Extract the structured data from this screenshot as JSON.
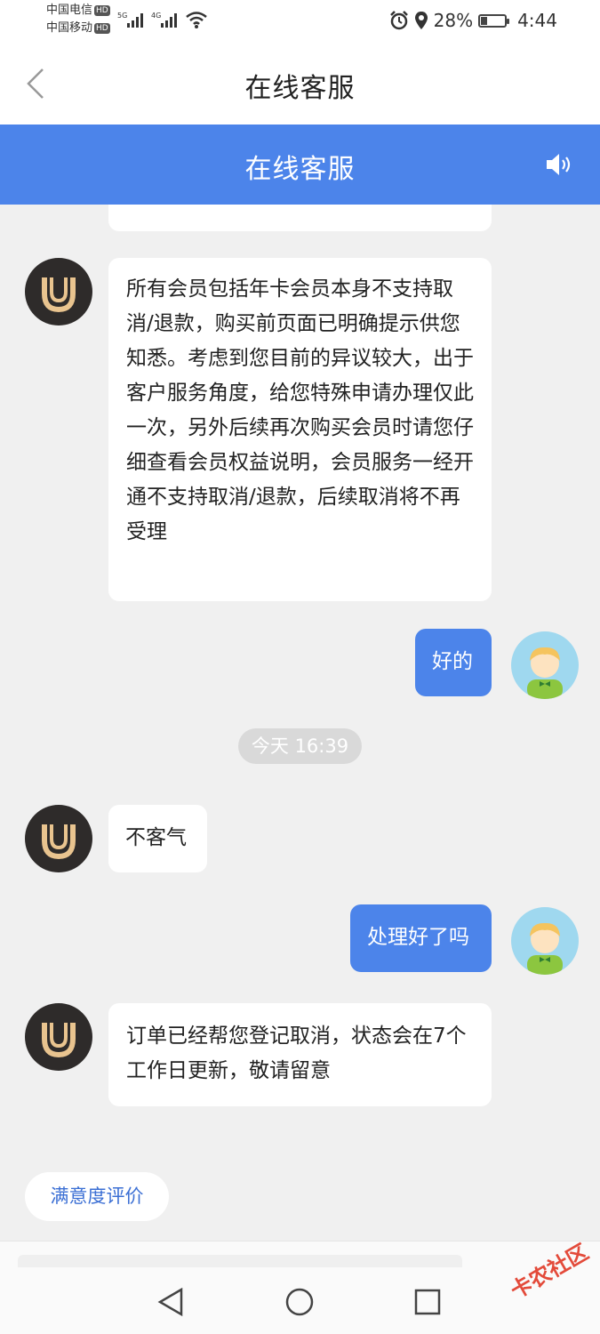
{
  "status_bar": {
    "carrier1": "中国电信",
    "carrier2": "中国移动",
    "hd": "HD",
    "net1": "5G",
    "net2": "4G",
    "battery_percent": "28%",
    "battery_level": 0.28,
    "time": "4:44"
  },
  "nav": {
    "title": "在线客服"
  },
  "header": {
    "title": "在线客服"
  },
  "messages": [
    {
      "from": "agent",
      "text": "所有会员包括年卡会员本身不支持取消/退款，购买前页面已明确提示供您知悉。考虑到您目前的异议较大，出于客户服务角度，给您特殊申请办理仅此一次，另外后续再次购买会员时请您仔细查看会员权益说明，会员服务一经开通不支持取消/退款，后续取消将不再受理"
    },
    {
      "from": "user",
      "text": "好的"
    },
    {
      "from": "agent",
      "text": "不客气"
    },
    {
      "from": "user",
      "text": "处理好了吗"
    },
    {
      "from": "agent",
      "text": "订单已经帮您登记取消，状态会在7个工作日更新，敬请留意"
    }
  ],
  "timestamp": "今天 16:39",
  "rate_button": "满意度评价",
  "watermark": "卡农社区",
  "colors": {
    "brand": "#4c84ea",
    "bot_avatar": "#2e2b2a",
    "gold": "#e9c48f"
  },
  "icons": [
    "back-icon",
    "speaker-icon",
    "alarm-icon",
    "location-icon",
    "wifi-icon",
    "nav-back-icon",
    "nav-home-icon",
    "nav-recent-icon"
  ]
}
